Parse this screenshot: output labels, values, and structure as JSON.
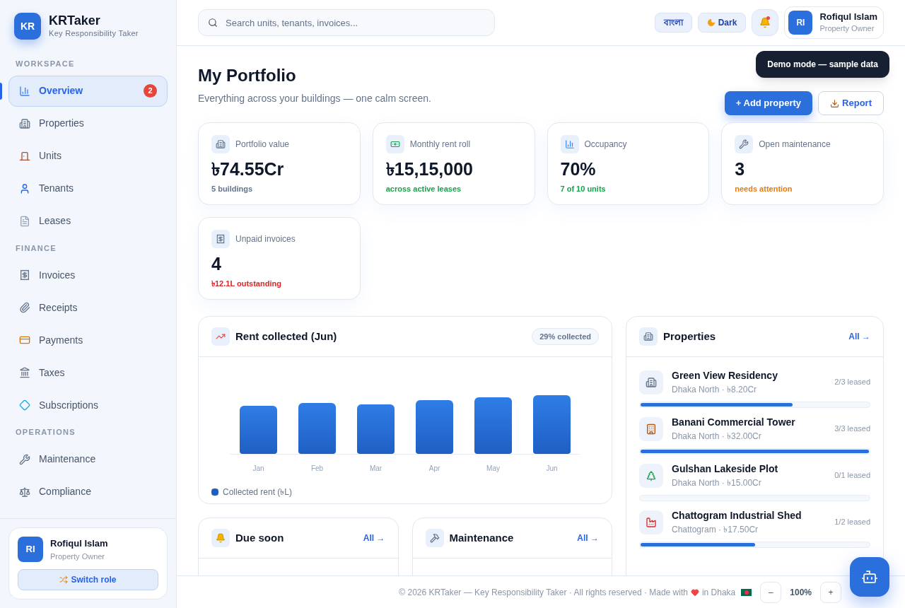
{
  "brand": {
    "initials": "KR",
    "name": "KRTaker",
    "tagline": "Key Responsibility Taker"
  },
  "sidebar": {
    "sections": [
      {
        "title": "WORKSPACE",
        "items": [
          {
            "label": "Overview",
            "selected": true,
            "badge": "2"
          },
          {
            "label": "Properties",
            "selected": false
          },
          {
            "label": "Units",
            "selected": false
          },
          {
            "label": "Tenants",
            "selected": false
          },
          {
            "label": "Leases",
            "selected": false
          }
        ]
      },
      {
        "title": "FINANCE",
        "items": [
          {
            "label": "Invoices",
            "selected": false
          },
          {
            "label": "Receipts",
            "selected": false
          },
          {
            "label": "Payments",
            "selected": false
          },
          {
            "label": "Taxes",
            "selected": false
          },
          {
            "label": "Subscriptions",
            "selected": false
          }
        ]
      },
      {
        "title": "OPERATIONS",
        "items": [
          {
            "label": "Maintenance",
            "selected": false
          },
          {
            "label": "Compliance",
            "selected": false
          }
        ]
      }
    ],
    "user": {
      "initials": "RI",
      "name": "Rofiqul Islam",
      "role": "Property Owner",
      "switch_label": "Switch role"
    }
  },
  "header": {
    "search": {
      "placeholder": "Search units, tenants, invoices..."
    },
    "language": "বাংলা",
    "theme": "Dark",
    "notifications_unread": true,
    "user": {
      "initials": "RI",
      "name": "Rofiqul Islam",
      "role": "Property Owner"
    }
  },
  "tooltip": "Demo mode — sample data",
  "page": {
    "title": "My Portfolio",
    "subtitle": "Everything across your buildings — one calm screen.",
    "primary_action": "+ Add property",
    "secondary_action": "Report"
  },
  "stats": [
    {
      "label": "Portfolio value",
      "value": "৳74.55Cr",
      "note": "5 buildings",
      "color": "#64748b"
    },
    {
      "label": "Monthly rent roll",
      "value": "৳15,15,000",
      "note": "across active leases",
      "color": "#16a34a"
    },
    {
      "label": "Occupancy",
      "value": "70%",
      "note": "7 of 10 units",
      "color": "#16a34a"
    },
    {
      "label": "Open maintenance",
      "value": "3",
      "note": "needs attention",
      "color": "#ea7a0c"
    },
    {
      "label": "Unpaid invoices",
      "value": "4",
      "note": "৳12.1L outstanding",
      "color": "#dc2626"
    }
  ],
  "rent_chart": {
    "title": "Rent collected (Jun)",
    "badge": "29% collected",
    "months": [
      "Jan",
      "Feb",
      "Mar",
      "Apr",
      "May",
      "Jun"
    ],
    "legend": "Collected rent (৳L)"
  },
  "due_soon": {
    "title": "Due soon",
    "link": "All →"
  },
  "maintenance": {
    "title": "Maintenance",
    "link": "All →"
  },
  "properties": {
    "title": "Properties",
    "link": "All →",
    "items": [
      {
        "name": "Green View Residency",
        "detail": "Dhaka North · ৳8.20Cr",
        "leased": "2/3 leased",
        "level": 0.667
      },
      {
        "name": "Banani Commercial Tower",
        "detail": "Dhaka North · ৳32.00Cr",
        "leased": "3/3 leased",
        "level": 1
      },
      {
        "name": "Gulshan Lakeside Plot",
        "detail": "Dhaka North · ৳15.00Cr",
        "leased": "0/1 leased",
        "level": 0
      },
      {
        "name": "Chattogram Industrial Shed",
        "detail": "Chattogram · ৳17.50Cr",
        "leased": "1/2 leased",
        "level": 0.5
      }
    ]
  },
  "footer": {
    "text": "© 2026 KRTaker — Key Responsibility Taker · All rights reserved · Made with",
    "place": "in Dhaka",
    "zoom_out": "–",
    "zoom": "100%",
    "zoom_in": "+"
  }
}
